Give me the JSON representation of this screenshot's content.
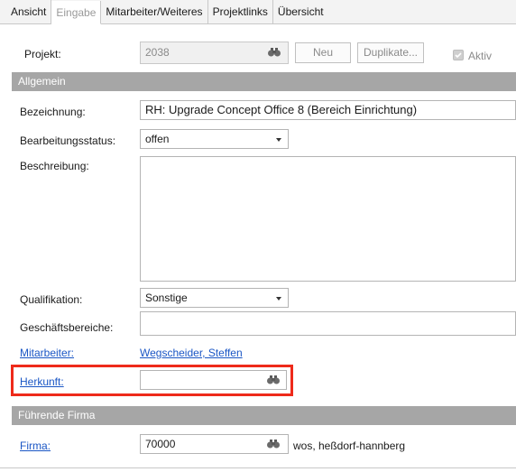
{
  "tabs": [
    {
      "label": "Ansicht"
    },
    {
      "label": "Eingabe",
      "active": true
    },
    {
      "label": "Mitarbeiter/Weiteres"
    },
    {
      "label": "Projektlinks"
    },
    {
      "label": "Übersicht"
    }
  ],
  "project": {
    "label": "Projekt:",
    "value": "2038",
    "new_button": "Neu",
    "duplicate_button": "Duplikate...",
    "active_label": "Aktiv",
    "active_checked": true
  },
  "section_general": "Allgemein",
  "fields": {
    "bezeichnung_label": "Bezeichnung:",
    "bezeichnung_value": "RH: Upgrade Concept Office 8 (Bereich Einrichtung)",
    "status_label": "Bearbeitungsstatus:",
    "status_value": "offen",
    "beschreibung_label": "Beschreibung:",
    "beschreibung_value": "",
    "qualifikation_label": "Qualifikation:",
    "qualifikation_value": "Sonstige",
    "geschaeftsbereiche_label": "Geschäftsbereiche:",
    "geschaeftsbereiche_value": "",
    "mitarbeiter_label": "Mitarbeiter:",
    "mitarbeiter_value": "Wegscheider, Steffen",
    "herkunft_label": "Herkunft:",
    "herkunft_value": ""
  },
  "section_company": "Führende Firma",
  "company": {
    "firma_label": "Firma:",
    "firma_value": "70000",
    "firma_name": "wos, heßdorf-hannberg"
  },
  "colors": {
    "section_bg": "#a6a6a6",
    "link": "#1a56c5",
    "highlight": "#ee2a1a"
  },
  "icons": {
    "lookup": "binoculars-icon",
    "dropdown": "chevron-down-icon"
  }
}
